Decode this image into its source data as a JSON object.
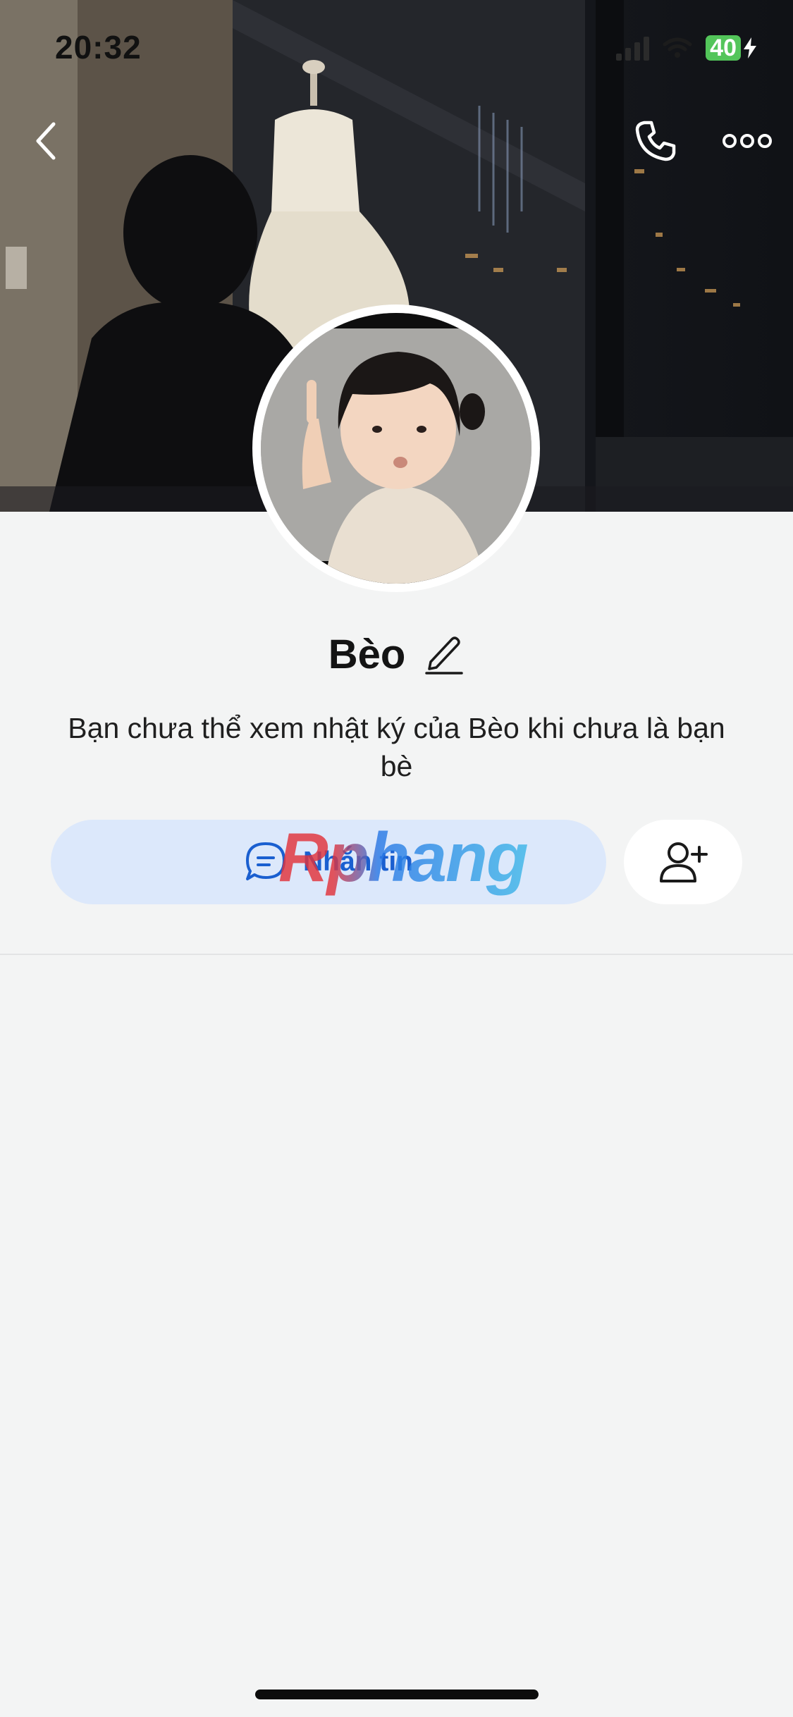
{
  "status_bar": {
    "time": "20:32",
    "battery": "40"
  },
  "profile": {
    "name": "Bèo",
    "notice": "Bạn chưa thể xem nhật ký của Bèo khi chưa là bạn bè"
  },
  "actions": {
    "message_label": "Nhắn tin"
  },
  "watermark": {
    "text": "Rphang"
  },
  "colors": {
    "page_background": "#f3f4f4",
    "accent_blue": "#1a5fd0",
    "message_button_bg": "#dce8fb",
    "battery_green": "#53c55a"
  },
  "icons": {
    "back": "chevron-left-icon",
    "call": "phone-icon",
    "more": "more-horizontal-icon",
    "edit": "pencil-icon",
    "message": "chat-bubble-icon",
    "add_friend": "user-plus-icon"
  }
}
